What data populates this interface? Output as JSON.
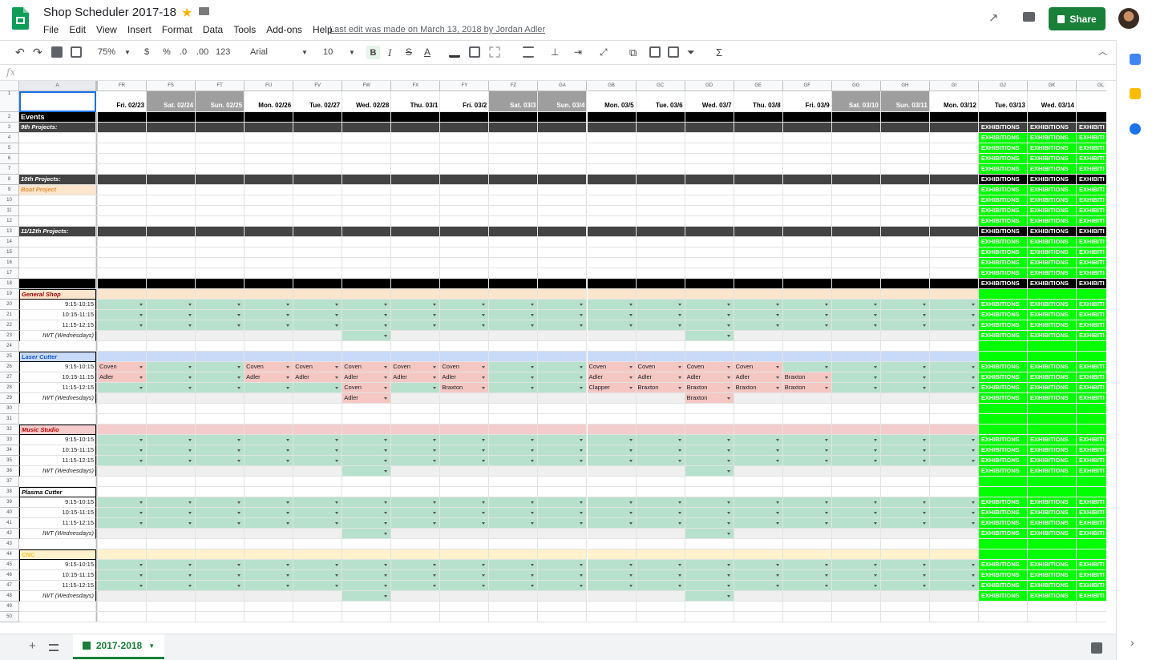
{
  "app": {
    "title": "Shop Scheduler 2017-18",
    "last_edit": "Last edit was made on March 13, 2018 by Jordan Adler",
    "share_label": "Share",
    "menu": [
      "File",
      "Edit",
      "View",
      "Insert",
      "Format",
      "Data",
      "Tools",
      "Add-ons",
      "Help"
    ]
  },
  "toolbar": {
    "zoom": "75%",
    "currency": "$",
    "percent": "%",
    "dec_less": ".0",
    "dec_more": ".00",
    "num_format": "123",
    "font": "Arial",
    "font_size": "10",
    "bold": "B",
    "italic": "I",
    "strike": "S",
    "textcolor": "A",
    "sum": "Σ"
  },
  "formula_bar": {
    "fx": "fx",
    "value": ""
  },
  "sheet_tab": "2017-2018",
  "col_letter_a": "A",
  "col_letters": [
    "FR",
    "FS",
    "FT",
    "FU",
    "FV",
    "FW",
    "FX",
    "FY",
    "FZ",
    "GA",
    "GB",
    "GC",
    "GD",
    "GE",
    "GF",
    "GG",
    "GH",
    "GI",
    "GJ",
    "GK",
    "GL"
  ],
  "dates": [
    "Fri. 02/23",
    "Sat. 02/24",
    "Sun. 02/25",
    "Mon. 02/26",
    "Tue. 02/27",
    "Wed. 02/28",
    "Thu. 03/1",
    "Fri. 03/2",
    "Sat. 03/3",
    "Sun. 03/4",
    "Mon. 03/5",
    "Tue. 03/6",
    "Wed. 03/7",
    "Thu. 03/8",
    "Fri. 03/9",
    "Sat. 03/10",
    "Sun. 03/11",
    "Mon. 03/12",
    "Tue. 03/13",
    "Wed. 03/14",
    "Thu."
  ],
  "weekend_cols": [
    1,
    2,
    8,
    9,
    15,
    16
  ],
  "exhibitions_text": "EXHIBITIONS",
  "exhibitions_short": "EXHIBITI",
  "col_a": {
    "2": "Events",
    "3": "9th Projects:",
    "8": "10th Projects:",
    "9": "Boat Project",
    "13": "11/12th Projects:",
    "19": "General Shop",
    "20": "9:15-10:15",
    "21": "10:15-11:15",
    "22": "11:15-12:15",
    "23": "IWT (Wednesdays)",
    "25": "Laser Cutter",
    "26": "9:15-10:15",
    "27": "10:15-11:15",
    "28": "11:15-12:15",
    "29": "IWT (Wednesdays)",
    "32": "Music Studio",
    "33": "9:15-10:15",
    "34": "10:15-11:15",
    "35": "11:15-12:15",
    "36": "IWT (Wednesdays)",
    "38": "Plasma Cutter",
    "39": "9:15-10:15",
    "40": "10:15-11:15",
    "41": "11:15-12:15",
    "42": "IWT (Wednesdays)",
    "44": "CNC",
    "45": "9:15-10:15",
    "46": "10:15-11:15",
    "47": "11:15-12:15",
    "48": "IWT (Wednesdays)"
  },
  "bookings": {
    "26": [
      "Coven",
      "",
      "",
      "Coven",
      "Coven",
      "Coven",
      "Coven",
      "Coven",
      "",
      "",
      "Coven",
      "Coven",
      "Coven",
      "Coven",
      "",
      "",
      "",
      ""
    ],
    "27": [
      "Adler",
      "",
      "",
      "Adler",
      "Adler",
      "Adler",
      "Adler",
      "Adler",
      "",
      "",
      "Adler",
      "Adler",
      "Adler",
      "Adler",
      "Braxton",
      "",
      "",
      ""
    ],
    "28": [
      "",
      "",
      "",
      "",
      "",
      "Coven",
      "",
      "Braxton",
      "",
      "",
      "Clapper",
      "Braxton",
      "Braxton",
      "Braxton",
      "Braxton",
      "",
      "",
      ""
    ],
    "29": [
      "",
      "",
      "",
      "",
      "",
      "Adler",
      "",
      "",
      "",
      "",
      "",
      "",
      "Braxton",
      "",
      "",
      "",
      "",
      ""
    ]
  },
  "colors": {
    "green_cell": "#b7e1cd",
    "red_cell": "#f4c7c3",
    "exhibitions": "#00ff00",
    "section_dark": "#434343",
    "general_shop": "#fce5cd",
    "laser_cutter": "#c9daf8",
    "music_studio": "#f4cccc",
    "cnc": "#fff2cc",
    "share": "#188038"
  }
}
